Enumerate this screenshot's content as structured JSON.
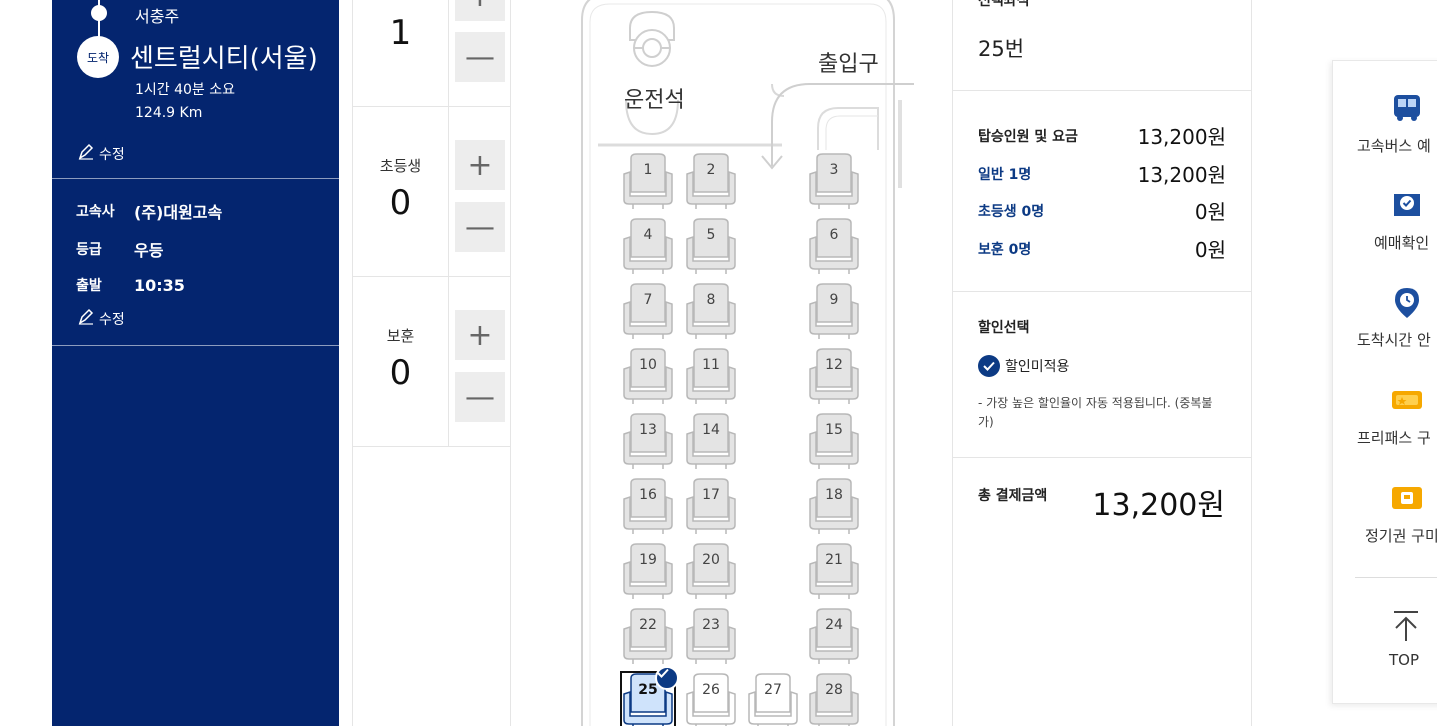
{
  "route": {
    "departure": "서충주",
    "arrival_badge": "도착",
    "arrival": "센트럴시티(서울)",
    "duration": "1시간 40분 소요",
    "distance": "124.9 Km",
    "edit_label": "수정"
  },
  "bus_info": {
    "company_key": "고속사",
    "company_val": "(주)대원고속",
    "grade_key": "등급",
    "grade_val": "우등",
    "depart_key": "출발",
    "depart_val": "10:35",
    "edit_label": "수정"
  },
  "counts": {
    "adult": {
      "label": "",
      "value": "1"
    },
    "child": {
      "label": "초등생",
      "value": "0"
    },
    "veteran": {
      "label": "보훈",
      "value": "0"
    },
    "plus": "+",
    "minus": "—"
  },
  "bus_map": {
    "driver": "운전석",
    "entrance": "출입구",
    "seats": [
      "1",
      "2",
      "3",
      "4",
      "5",
      "6",
      "7",
      "8",
      "9",
      "10",
      "11",
      "12",
      "13",
      "14",
      "15",
      "16",
      "17",
      "18",
      "19",
      "20",
      "21",
      "22",
      "23",
      "24",
      "25",
      "26",
      "27",
      "28"
    ],
    "selected_seat": "25",
    "colors": {
      "accent": "#0c3a84",
      "seat_fill": "#e4e4e4",
      "selected_fill": "#cfe3fb"
    }
  },
  "summary": {
    "selected_title": "선택좌석",
    "selected_value": "25번",
    "fare_title": "탑승인원 및 요금",
    "fare_total": "13,200원",
    "adult_label": "일반 1명",
    "adult_fare": "13,200원",
    "child_label": "초등생 0명",
    "child_fare": "0원",
    "veteran_label": "보훈 0명",
    "veteran_fare": "0원",
    "discount_title": "할인선택",
    "discount_option": "할인미적용",
    "discount_note": "- 가장 높은 할인율이 자동 적용됩니다. (중복불가)",
    "total_label": "총 결제금액",
    "total_value": "13,200원"
  },
  "quick_menu": {
    "items": [
      {
        "label": "고속버스 예",
        "icon": "bus-icon"
      },
      {
        "label": "예매확인",
        "icon": "ticket-check-icon"
      },
      {
        "label": "도착시간 안",
        "icon": "location-clock-icon"
      },
      {
        "label": "프리패스 구",
        "icon": "freepass-icon"
      },
      {
        "label": "정기권 구미",
        "icon": "season-ticket-icon"
      }
    ],
    "top_label": "TOP"
  }
}
